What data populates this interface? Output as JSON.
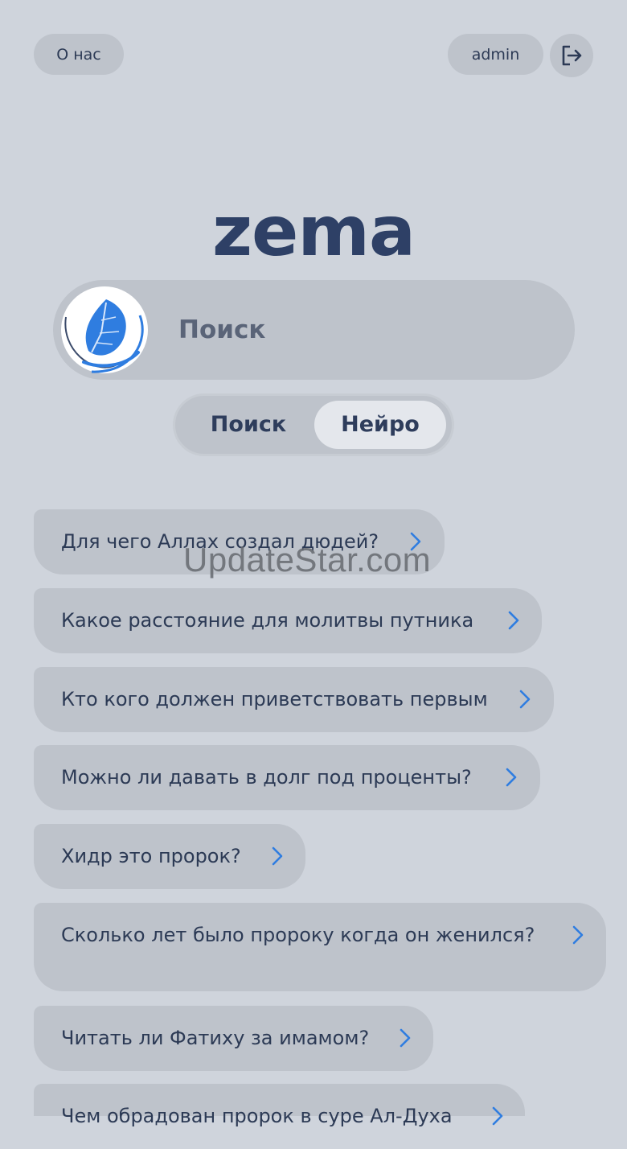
{
  "header": {
    "about_label": "О нас",
    "user_label": "admin",
    "logout_icon": "logout-icon"
  },
  "logo_text": "zema",
  "search": {
    "placeholder": "Поиск",
    "logo_icon": "leaf-globe-logo"
  },
  "mode_toggle": {
    "options": [
      "Поиск",
      "Нейро"
    ],
    "selected": "Нейро"
  },
  "suggestions": [
    "Для чего Аллах создал дюдей?",
    "Какое расстояние для молитвы путника",
    "Кто кого должен приветствовать первым",
    "Можно ли давать в долг под проценты?",
    "Хидр это пророк?",
    "Сколько лет было пророку когда он женился?",
    "Читать ли Фатиху за имамом?",
    "Чем обрадован пророк в суре Ал-Духа"
  ],
  "watermark": "UpdateStar.com",
  "colors": {
    "background": "#cfd4dc",
    "pill": "#bec3cb",
    "accent": "#2f7de0",
    "logo": "#2e4066"
  }
}
